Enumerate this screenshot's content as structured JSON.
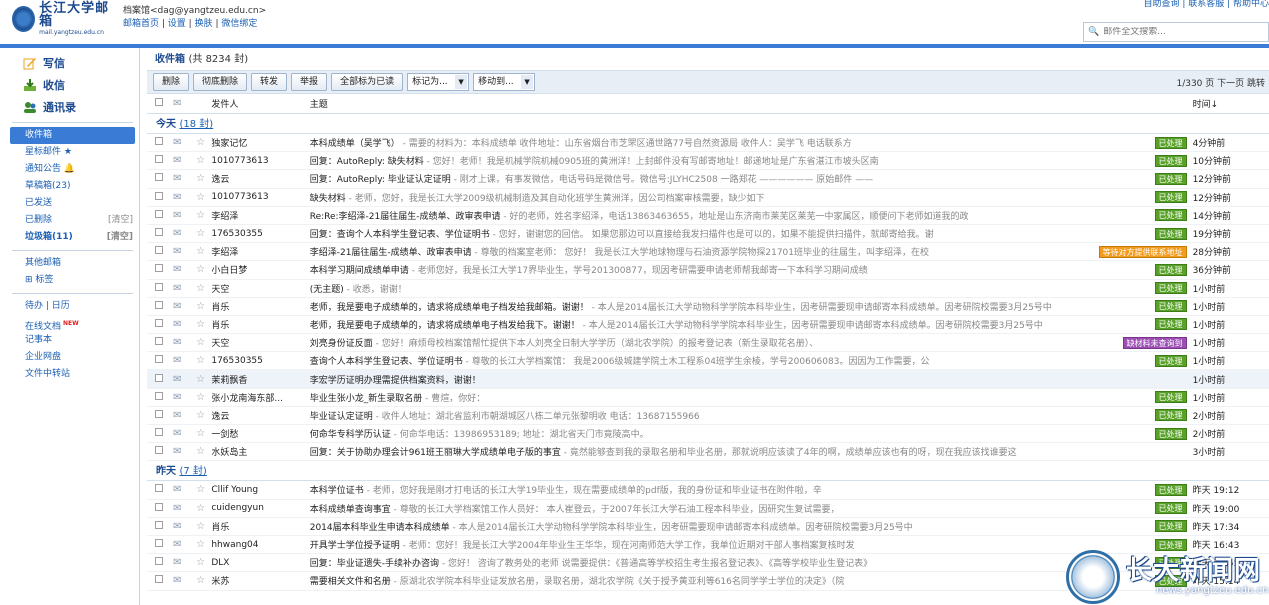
{
  "header": {
    "logo_text": "长江大学邮箱",
    "logo_sub": "mail.yangtzeu.edu.cn",
    "user": "档案馆<dag@yangtzeu.edu.cn>",
    "links": [
      "邮箱首页",
      "设置",
      "换肤",
      "微信绑定"
    ],
    "top_links": "自助查询 | 联系客服 | 帮助中心",
    "search_placeholder": "邮件全文搜索..."
  },
  "sidebar": {
    "write": "写信",
    "receive": "收信",
    "contacts": "通讯录",
    "folders": [
      {
        "label": "收件箱",
        "selected": true
      },
      {
        "label": "星标邮件 ★"
      },
      {
        "label": "通知公告 🔔"
      },
      {
        "label": "草稿箱(23)"
      },
      {
        "label": "已发送"
      },
      {
        "label": "已删除",
        "clear": "[清空]"
      },
      {
        "label": "垃圾箱(11)",
        "clear": "[清空]",
        "bold": true
      }
    ],
    "other_folders": "其他邮箱",
    "tags": "⊞ 标签",
    "tools": [
      {
        "label": "待办 | 日历"
      },
      {
        "label": "在线文档",
        "badge": "NEW"
      },
      {
        "label": "记事本"
      },
      {
        "label": "企业网盘"
      },
      {
        "label": "文件中转站"
      }
    ]
  },
  "main": {
    "title": "收件箱",
    "count": "(共 8234 封)",
    "toolbar": [
      "删除",
      "彻底删除",
      "转发",
      "举报",
      "全部标为已读"
    ],
    "mark_as": "标记为...",
    "move_to": "移动到...",
    "pager": "1/330 页 下一页 跳转",
    "col_from": "发件人",
    "col_subject": "主题",
    "col_time": "时间↓",
    "groups": [
      {
        "label": "今天",
        "count": "(18 封)",
        "rows": [
          {
            "from": "独家记忆",
            "subject": "本科成绩单（吴学飞）",
            "preview": " - 需要的材料为：本科成绩单 收件地址：山东省烟台市芝罘区通世路77号自然资源局 收件人：吴学飞 电话联系方",
            "tag": "已处理",
            "tag_color": "green",
            "time": "4分钟前"
          },
          {
            "from": "1010773613",
            "subject": "回复：AutoReply: 缺失材料",
            "preview": " - 您好！老师！我是机械学院机械0905班的黄洲洋！上封邮件没有写邮寄地址！邮递地址是广东省湛江市坡头区南",
            "tag": "已处理",
            "tag_color": "green",
            "time": "10分钟前"
          },
          {
            "from": "逸云",
            "subject": "回复：AutoReply: 毕业证认定证明",
            "preview": " - 刚才上课，有事发微信，电话号码是微信号。微信号:JLYHC2508 一路郑花 —————— 原始邮件 ——",
            "tag": "已处理",
            "tag_color": "green",
            "time": "12分钟前"
          },
          {
            "from": "1010773613",
            "subject": "缺失材料",
            "preview": " - 老师，您好，我是长江大学2009级机械制造及其自动化班学生黄洲洋，因公司档案审核需要，缺少如下",
            "tag": "已处理",
            "tag_color": "green",
            "time": "12分钟前"
          },
          {
            "from": "李绍泽",
            "subject": "Re:Re:李绍泽-21届往届生-成绩单、政审表申请",
            "preview": " - 好的老师，姓名李绍泽，电话13863463655，地址是山东济南市莱芜区莱芜一中家属区，顺便问下老师如道我的政",
            "tag": "已处理",
            "tag_color": "green",
            "time": "14分钟前"
          },
          {
            "from": "176530355",
            "subject": "回复：查询个人本科学生登记表、学位证明书",
            "preview": " - 您好，谢谢您的回信。 如果您那边可以直接给我发扫描件也是可以的，如果不能提供扫描件，就邮寄给我。谢",
            "tag": "已处理",
            "tag_color": "green",
            "time": "19分钟前"
          },
          {
            "from": "李绍泽",
            "subject": "李绍泽-21届往届生-成绩单、政审表申请",
            "preview": " - 尊敬的档案室老师： 您好！ 我是长江大学地球物理与石油资源学院物探21701班毕业的往届生，叫李绍泽，在校",
            "tag": "等待对方提供联系地址",
            "tag_color": "orange",
            "time": "28分钟前"
          },
          {
            "from": "小白日梦",
            "subject": "本科学习期间成绩单申请",
            "preview": " - 老师您好，我是长江大学17界毕业生，学号201300877，现因考研需要申请老师帮我邮寄一下本科学习期间成绩",
            "tag": "已处理",
            "tag_color": "green",
            "time": "36分钟前"
          },
          {
            "from": "天空",
            "subject": "(无主题)",
            "preview": " - 收悉，谢谢！",
            "tag": "已处理",
            "tag_color": "green",
            "time": "1小时前"
          },
          {
            "from": "肖乐",
            "subject": "老师，我是要电子成绩单的，请求将成绩单电子档发给我邮箱。谢谢！",
            "preview": " - 本人是2014届长江大学动物科学学院本科毕业生，因考研需要现申请邮寄本科成绩单。因考研院校需要3月25号中",
            "tag": "已处理",
            "tag_color": "green",
            "time": "1小时前"
          },
          {
            "from": "肖乐",
            "subject": "老师，我是要电子成绩单的，请求将成绩单电子档发给我下。谢谢！",
            "preview": " - 本人是2014届长江大学动物科学学院本科毕业生，因考研需要现申请邮寄本科成绩单。因考研院校需要3月25号中",
            "tag": "已处理",
            "tag_color": "green",
            "time": "1小时前"
          },
          {
            "from": "天空",
            "subject": "刘亮身份证反面",
            "preview": " - 您好！麻烦母校档案馆帮忙提供下本人刘亮全日制大学学历（湖北农学院）的报考登记表（新生录取花名册）、",
            "tag": "缺材料未查询到",
            "tag_color": "purple",
            "time": "1小时前"
          },
          {
            "from": "176530355",
            "subject": "查询个人本科学生登记表、学位证明书",
            "preview": " - 尊敬的长江大学档案馆： 我是2006级城建学院土木工程系04班学生余棱，学号200606083。因因为工作需要，公",
            "tag": "已处理",
            "tag_color": "green",
            "time": "1小时前"
          },
          {
            "from": "茉莉飘香",
            "subject": "李宏学历证明办理需提供档案资料，谢谢！",
            "preview": "",
            "tag": "",
            "tag_color": "",
            "time": "1小时前",
            "highlight": true
          },
          {
            "from": "张小龙南海东部...",
            "subject": "毕业生张小龙_新生录取名册",
            "preview": " - 曹煊，你好：",
            "tag": "已处理",
            "tag_color": "green",
            "time": "1小时前"
          },
          {
            "from": "逸云",
            "subject": "毕业证认定证明",
            "preview": " - 收件人地址：湖北省监利市朝湖城区八栋二单元张黎明收 电话：13687155966",
            "tag": "已处理",
            "tag_color": "green",
            "time": "2小时前"
          },
          {
            "from": "一剑愁",
            "subject": "何命华专科学历认证",
            "preview": " - 何命华电话：13986953189; 地址：湖北省天门市竟陵高中。",
            "tag": "已处理",
            "tag_color": "green",
            "time": "2小时前"
          },
          {
            "from": "水妖岛主",
            "subject": "回复：关于协助办理会计961班王丽琳大学成绩单电子版的事宜",
            "preview": " - 竟然能够查到我的录取名册和毕业名册，那就说明应该读了4年的啊，成绩单应该也有的呀，现在我应该找谁要这",
            "tag": "",
            "tag_color": "",
            "time": "3小时前"
          }
        ]
      },
      {
        "label": "昨天",
        "count": "(7 封)",
        "rows": [
          {
            "from": "Cllif Young",
            "subject": "本科学位证书",
            "preview": " - 老师，您好我是刚才打电话的长江大学19毕业生，现在需要成绩单的pdf版，我的身份证和毕业证书在附件啦，辛",
            "tag": "已处理",
            "tag_color": "green",
            "time": "昨天 19:12"
          },
          {
            "from": "cuidengyun",
            "subject": "本科成绩单查询事宜",
            "preview": " - 尊敬的长江大学档案馆工作人员好： 本人崔登云，于2007年长江大学石油工程本科毕业，因研究生复试需要，",
            "tag": "已处理",
            "tag_color": "green",
            "time": "昨天 19:00"
          },
          {
            "from": "肖乐",
            "subject": "2014届本科毕业生申请本科成绩单",
            "preview": " - 本人是2014届长江大学动物科学学院本科毕业生，因考研需要现申请邮寄本科成绩单。因考研院校需要3月25号中",
            "tag": "已处理",
            "tag_color": "green",
            "time": "昨天 17:34"
          },
          {
            "from": "hhwang04",
            "subject": "开具学士学位授予证明",
            "preview": " - 老师：您好！我是长江大学2004年毕业生王华华，现在河南师范大学工作，我单位近期对干部人事档案复核时发",
            "tag": "已处理",
            "tag_color": "green",
            "time": "昨天 16:43"
          },
          {
            "from": "DLX",
            "subject": "回复：毕业证遗失-手续补办咨询",
            "preview": " - 您好！ 咨询了教务处的老师 说需要提供：《普通高等学校招生考生报名登记表》、《高等学校毕业生登记表》",
            "tag": "已处理",
            "tag_color": "green",
            "time": "昨天 15:55"
          },
          {
            "from": "米苏",
            "subject": "需要相关文件和名册",
            "preview": " - 原湖北农学院本科毕业证发放名册，录取名册，湖北农学院《关于授予黄亚利等616名同学学士学位的决定》（院",
            "tag": "已处理",
            "tag_color": "green",
            "time": "昨天 15:14"
          }
        ]
      }
    ]
  },
  "watermark": {
    "title": "长大新闻网",
    "url": "news.yangtzeu.edu.cn"
  },
  "colors": {
    "accent": "#3a7bd5",
    "done": "#5aa12a",
    "waiting": "#f29b1d",
    "missing": "#9b4fb3"
  }
}
